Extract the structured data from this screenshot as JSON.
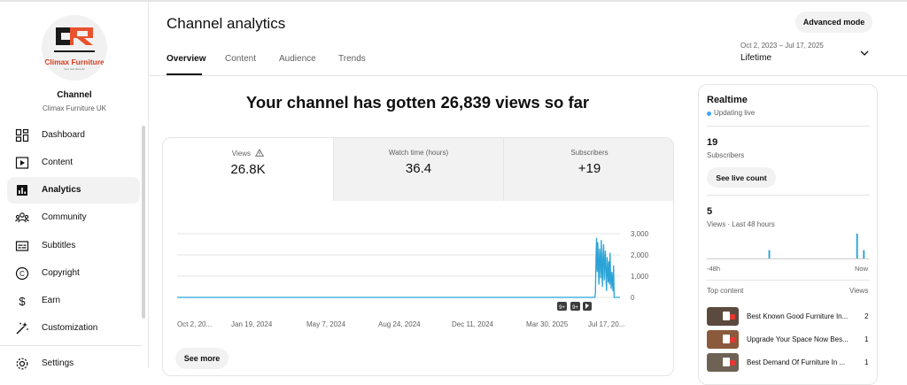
{
  "sidebar": {
    "logo": {
      "brand": "Climax Furniture",
      "tagline": "Your new lifestyle!"
    },
    "channel_label": "Channel",
    "channel_name": "Climax Furniture UK",
    "items": [
      {
        "label": "Dashboard",
        "icon": "dashboard-icon"
      },
      {
        "label": "Content",
        "icon": "content-icon"
      },
      {
        "label": "Analytics",
        "icon": "analytics-icon",
        "active": true
      },
      {
        "label": "Community",
        "icon": "community-icon"
      },
      {
        "label": "Subtitles",
        "icon": "subtitles-icon"
      },
      {
        "label": "Copyright",
        "icon": "copyright-icon"
      },
      {
        "label": "Earn",
        "icon": "earn-icon"
      },
      {
        "label": "Customization",
        "icon": "customization-icon"
      },
      {
        "label": "Settings",
        "icon": "settings-icon"
      }
    ]
  },
  "header": {
    "title": "Channel analytics",
    "advanced_mode": "Advanced mode",
    "tabs": [
      "Overview",
      "Content",
      "Audience",
      "Trends"
    ],
    "date_range": "Oct 2, 2023 – Jul 17, 2025",
    "period": "Lifetime"
  },
  "headline": "Your channel has gotten 26,839 views so far",
  "metrics": [
    {
      "label": "Views",
      "value": "26.8K",
      "warning": true
    },
    {
      "label": "Watch time (hours)",
      "value": "36.4"
    },
    {
      "label": "Subscribers",
      "value": "+19"
    }
  ],
  "see_more": "See more",
  "chart_data": {
    "type": "line",
    "series": [
      {
        "values": [
          0,
          0,
          0,
          0,
          0,
          0,
          0,
          0,
          0,
          0,
          0,
          0,
          0,
          0,
          0,
          0,
          0,
          0,
          0,
          0,
          0,
          0,
          0,
          0,
          0,
          0,
          0,
          0,
          0,
          0,
          0,
          0,
          0,
          0,
          0,
          0,
          0,
          0,
          0,
          0,
          0,
          0,
          0,
          0,
          0,
          0,
          0,
          0,
          0,
          0,
          0,
          0,
          0,
          0,
          0,
          0,
          0,
          0,
          0,
          0,
          0,
          0,
          0,
          0,
          0,
          0,
          0,
          0,
          0,
          0,
          0,
          0,
          0,
          0,
          0,
          0,
          0,
          0,
          0,
          0,
          0,
          0,
          0,
          0,
          0,
          0,
          0,
          0,
          0,
          0,
          0,
          0,
          0,
          0,
          0,
          0,
          0,
          0,
          0,
          0,
          0,
          0,
          0,
          0,
          0,
          0,
          0,
          0,
          0,
          0,
          0,
          0,
          0,
          0,
          0,
          0,
          0,
          0,
          0,
          0,
          0,
          0,
          0,
          0,
          0,
          0,
          0,
          0,
          0,
          0,
          0,
          0,
          0,
          0,
          0,
          0,
          0,
          0,
          0,
          0,
          0,
          0,
          0,
          0,
          0,
          0,
          0,
          0,
          0,
          0,
          0,
          0,
          0,
          0,
          0,
          0,
          0,
          0,
          0,
          0,
          0,
          0,
          0,
          0,
          0,
          0,
          0,
          0,
          0,
          0,
          0,
          0,
          0,
          0,
          0,
          0,
          0,
          0,
          0,
          0,
          0,
          0,
          0,
          0,
          0,
          0,
          0,
          0,
          0,
          0,
          0,
          0,
          0,
          0,
          0,
          0,
          0,
          0,
          0,
          0,
          0,
          0,
          0,
          0,
          0,
          0,
          0,
          0,
          0,
          0,
          0,
          0,
          0,
          0,
          0,
          0,
          0,
          0,
          0,
          0,
          0,
          0,
          0,
          0,
          0,
          0,
          0,
          0,
          0,
          0,
          0,
          0,
          0,
          0,
          0,
          0,
          0,
          0,
          0,
          0,
          0,
          0,
          0,
          0,
          0,
          0,
          0,
          0,
          0,
          0,
          0,
          0,
          0,
          0,
          0,
          0,
          0,
          0,
          0,
          0,
          0,
          0,
          0,
          0,
          0,
          0,
          0,
          0,
          0,
          0,
          0,
          0,
          0,
          0,
          0,
          0,
          0,
          0,
          0,
          0,
          0,
          0,
          0,
          0,
          0,
          0,
          0,
          0,
          0,
          0,
          0,
          0,
          0,
          0,
          0,
          0,
          0,
          0,
          0,
          0,
          0,
          0,
          0,
          0,
          0,
          0,
          0,
          0,
          0,
          0,
          0,
          0,
          0,
          0,
          0,
          0,
          0,
          0,
          0,
          0,
          0,
          0,
          0,
          0,
          0,
          0,
          0,
          0,
          0,
          0,
          0,
          0,
          0,
          0,
          0,
          0,
          0,
          0,
          0,
          0,
          0,
          0,
          0,
          0,
          0,
          0,
          0,
          0,
          0,
          0,
          0,
          0,
          0,
          0,
          0,
          0,
          0,
          0,
          0,
          0,
          0,
          0,
          0,
          0,
          0,
          0,
          0,
          0,
          0,
          0,
          0,
          0,
          0,
          0,
          0,
          0,
          0,
          0,
          0,
          0,
          0,
          0,
          0,
          0,
          0,
          0,
          0,
          0,
          0,
          0,
          0,
          0,
          0,
          0,
          0,
          0,
          0,
          0,
          0,
          0,
          0,
          0,
          0,
          0,
          0,
          0,
          0,
          0,
          0,
          0,
          0,
          0,
          0,
          0,
          0,
          0,
          0,
          0,
          0,
          0,
          0,
          0,
          0,
          0,
          0,
          0,
          0,
          0,
          0,
          0,
          0,
          0,
          0,
          0,
          0,
          0,
          0,
          0,
          0,
          0,
          0,
          0,
          0,
          0,
          0,
          0,
          0,
          0,
          0,
          0,
          0,
          0,
          0,
          0,
          0,
          0,
          0,
          0,
          0,
          0,
          0,
          0,
          0,
          0,
          0,
          0,
          0,
          0,
          0,
          0,
          0,
          0,
          0,
          0,
          0,
          0,
          0,
          0,
          0,
          0,
          0,
          0,
          0,
          0,
          0,
          0,
          0,
          0,
          0,
          0,
          0,
          0,
          0,
          0,
          0,
          0,
          0,
          0,
          0,
          0,
          0,
          0,
          0,
          0,
          0,
          0,
          0,
          0,
          0,
          0,
          0,
          0,
          0,
          0,
          0,
          0,
          0,
          0,
          0,
          0,
          0,
          0,
          0,
          0,
          0,
          0,
          0,
          0,
          0,
          0,
          0,
          0,
          0,
          0,
          0,
          0,
          0,
          0,
          0,
          0,
          0,
          0,
          0,
          0,
          0,
          0,
          0,
          0,
          0,
          0,
          0,
          0,
          0,
          0,
          0,
          0,
          0,
          0,
          0,
          0,
          0,
          0,
          0,
          0,
          0,
          0,
          0,
          0,
          0,
          0,
          0,
          0,
          0,
          0,
          0,
          0,
          0,
          0,
          0,
          0,
          0,
          0,
          0,
          0,
          0,
          0,
          0,
          0,
          0,
          0,
          0,
          0,
          0,
          0,
          0,
          0,
          0,
          0,
          0,
          0,
          0,
          0,
          0,
          0,
          0,
          0,
          0,
          0,
          0,
          0,
          0,
          0,
          0,
          0,
          0,
          0,
          0,
          0,
          0,
          0,
          0,
          0,
          0,
          0,
          0,
          0,
          0,
          0,
          0,
          0,
          0,
          0,
          0,
          0,
          0,
          0,
          0,
          0,
          0,
          0,
          0,
          0,
          0,
          0,
          0,
          0,
          0,
          0,
          0,
          0,
          0,
          0,
          0,
          0,
          0,
          0,
          0,
          0,
          0,
          0,
          0,
          0,
          0,
          0,
          0,
          0,
          0,
          0,
          0,
          0,
          0,
          0,
          0,
          0,
          0,
          0,
          0,
          0,
          0,
          0,
          0,
          0,
          0,
          0,
          0,
          0,
          0,
          0,
          0,
          0,
          0,
          0,
          0,
          0,
          0,
          0,
          0,
          0,
          0,
          0,
          0,
          0,
          0,
          0,
          0,
          0,
          0,
          0,
          0,
          0,
          0,
          0,
          0,
          0,
          200,
          1800,
          2800,
          1200,
          2600,
          1500,
          600,
          2300,
          1800,
          900,
          2700,
          1400,
          500,
          2000,
          2500,
          800,
          1600,
          2200,
          1000,
          300,
          1900,
          1300,
          700,
          1700,
          600,
          2100,
          900,
          400,
          1200,
          800,
          300,
          1500,
          0,
          0,
          0,
          0,
          0,
          0,
          0,
          0,
          0,
          0,
          0
        ]
      }
    ],
    "x_tick_labels": [
      "Oct 2, 20...",
      "Jan 19, 2024",
      "May 7, 2024",
      "Aug 24, 2024",
      "Dec 11, 2024",
      "Mar 30, 2025",
      "Jul 17, 20..."
    ],
    "y_tick_labels": [
      "3,000",
      "2,000",
      "1,000",
      "0"
    ],
    "ylim": [
      0,
      3000
    ],
    "markers": [
      "9+",
      "9+"
    ],
    "color": "#2ba3d6"
  },
  "realtime": {
    "title": "Realtime",
    "status": "Updating live",
    "subscribers": "19",
    "subscribers_label": "Subscribers",
    "see_live_count": "See live count",
    "views": "5",
    "views_label": "Views · Last 48 hours",
    "bars": [
      0,
      0,
      0,
      0,
      0,
      0,
      0,
      0,
      0,
      0,
      0,
      0,
      0,
      0,
      0,
      0,
      0,
      0,
      1,
      0,
      0,
      0,
      0,
      0,
      0,
      0,
      0,
      0,
      0,
      0,
      0,
      0,
      0,
      0,
      0,
      0,
      0,
      0,
      0,
      0,
      0,
      0,
      0,
      0,
      3,
      0,
      1,
      0
    ],
    "axis_start": "-48h",
    "axis_end": "Now",
    "top_content_label": "Top content",
    "views_col_label": "Views",
    "top_content": [
      {
        "title": "Best Known Good Furniture In...",
        "views": "2",
        "thumb_color": "#5c4a3e"
      },
      {
        "title": "Upgrade Your Space Now Bes...",
        "views": "1",
        "thumb_color": "#8b5a3c"
      },
      {
        "title": "Best Demand Of Furniture In ...",
        "views": "1",
        "thumb_color": "#6e6254"
      }
    ]
  }
}
